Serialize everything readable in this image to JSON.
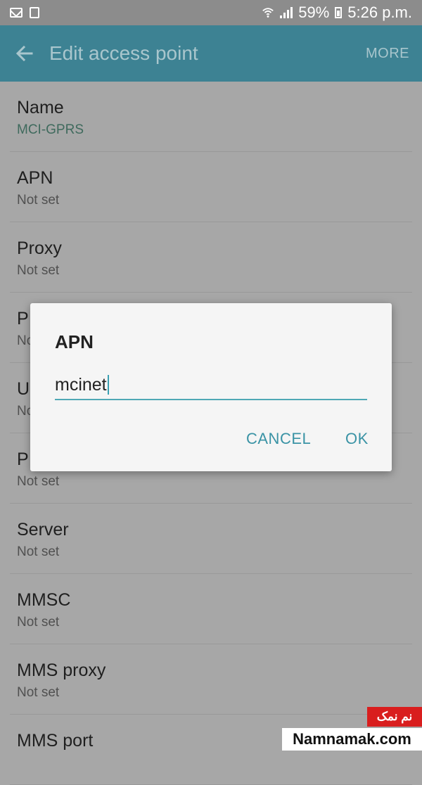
{
  "status_bar": {
    "battery": "59%",
    "time": "5:26 p.m."
  },
  "app_bar": {
    "title": "Edit access point",
    "more_label": "MORE"
  },
  "list": {
    "items": [
      {
        "title": "Name",
        "value": "MCI-GPRS"
      },
      {
        "title": "APN",
        "value": "Not set"
      },
      {
        "title": "Proxy",
        "value": "Not set"
      },
      {
        "title": "P",
        "value": "No"
      },
      {
        "title": "U",
        "value": "No"
      },
      {
        "title": "P",
        "value": "Not set"
      },
      {
        "title": "Server",
        "value": "Not set"
      },
      {
        "title": "MMSC",
        "value": "Not set"
      },
      {
        "title": "MMS proxy",
        "value": "Not set"
      },
      {
        "title": "MMS port",
        "value": ""
      }
    ]
  },
  "dialog": {
    "title": "APN",
    "input_value": "mcinet",
    "cancel_label": "CANCEL",
    "ok_label": "OK"
  },
  "watermark": {
    "brand_text": "نم نمک",
    "site_text": "Namnamak.com"
  },
  "colors": {
    "app_bar": "#3d8293",
    "accent": "#3a93a5"
  }
}
